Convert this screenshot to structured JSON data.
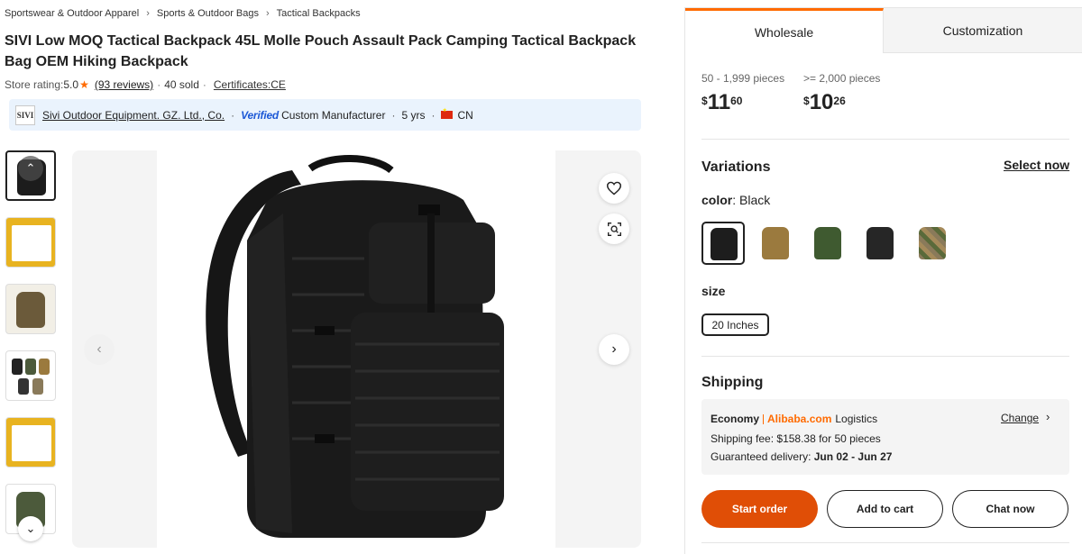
{
  "breadcrumb": [
    "Sportswear & Outdoor Apparel",
    "Sports & Outdoor Bags",
    "Tactical Backpacks"
  ],
  "product": {
    "title": "SIVI Low MOQ Tactical Backpack 45L Molle Pouch Assault Pack Camping Tactical Backpack Bag OEM Hiking Backpack",
    "store_rating_label": "Store rating:",
    "store_rating_value": "5.0",
    "reviews": "(93 reviews)",
    "sold": "40 sold",
    "certificates": "Certificates:CE"
  },
  "supplier": {
    "logo_text": "SIVI",
    "name": "Sivi Outdoor Equipment. GZ. Ltd., Co.",
    "verified": "Verified",
    "type": "Custom Manufacturer",
    "years": "5 yrs",
    "country": "CN"
  },
  "thumbnails": [
    {
      "name": "black",
      "color": "#1c1c1c",
      "bg": "#ffffff"
    },
    {
      "name": "infographic-1",
      "color": "#2a2a2a",
      "bg": "#e8b320"
    },
    {
      "name": "infographic-2",
      "color": "#6b5a3a",
      "bg": "#f2efe6"
    },
    {
      "name": "colors-grid",
      "color": "#4a5a3a",
      "bg": "#ffffff"
    },
    {
      "name": "infographic-3",
      "color": "#2a2a2a",
      "bg": "#e8b320"
    },
    {
      "name": "green-back",
      "color": "#4c5a3b",
      "bg": "#ffffff"
    }
  ],
  "tabs": {
    "active": "Wholesale",
    "inactive": "Customization"
  },
  "pricing": [
    {
      "range": "50 - 1,999 pieces",
      "currency": "$",
      "int": "11",
      "dec": "60"
    },
    {
      "range": ">= 2,000 pieces",
      "currency": "$",
      "int": "10",
      "dec": "26"
    }
  ],
  "variations": {
    "title": "Variations",
    "select_now": "Select now",
    "color_label": "color",
    "color_value": ": Black",
    "swatches": [
      {
        "name": "black",
        "color": "#1d1d1d"
      },
      {
        "name": "tan",
        "color": "#9b7a3e"
      },
      {
        "name": "green",
        "color": "#3f5a30"
      },
      {
        "name": "black-2",
        "color": "#262626"
      },
      {
        "name": "camo",
        "color": "#8a7a5a"
      }
    ],
    "size_label": "size",
    "size_value": "20 Inches"
  },
  "shipping": {
    "title": "Shipping",
    "method": "Economy",
    "carrier": "Alibaba.com",
    "carrier_suffix": "Logistics",
    "change": "Change",
    "fee": "Shipping fee: $158.38 for 50 pieces",
    "delivery_label": "Guaranteed delivery: ",
    "delivery_dates": "Jun 02 - Jun 27"
  },
  "actions": {
    "start_order": "Start order",
    "add_to_cart": "Add to cart",
    "chat_now": "Chat now"
  },
  "colors": {
    "accent": "#ff6a00",
    "primary_button": "#e04e06",
    "verified": "#1c58d6",
    "supplier_bg": "#eaf3fd"
  }
}
